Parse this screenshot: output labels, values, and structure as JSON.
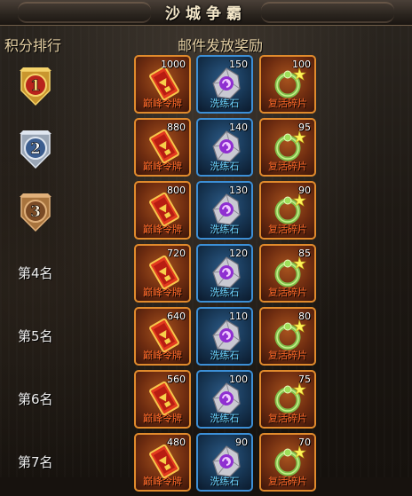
{
  "header": {
    "title": "沙城争霸",
    "rank_column": "积分排行",
    "reward_column": "邮件发放奖励"
  },
  "colors": {
    "gold_text": "#e4cfa3",
    "orange_frame": "#e08a2c",
    "blue_frame": "#3c8fd6",
    "orange_label": "#ff6a2a",
    "blue_label": "#6fd6ff"
  },
  "rows": [
    {
      "rank_badge": "1",
      "rank_icon": "gold-rank-medal-icon",
      "rewards": [
        {
          "name": "巅峰令牌",
          "count": "1000",
          "icon": "token-card-icon"
        },
        {
          "name": "洗练石",
          "count": "150",
          "icon": "purple-stone-icon"
        },
        {
          "name": "复活碎片",
          "count": "100",
          "icon": "green-ring-icon"
        }
      ]
    },
    {
      "rank_badge": "2",
      "rank_icon": "silver-rank-medal-icon",
      "rewards": [
        {
          "name": "巅峰令牌",
          "count": "880",
          "icon": "token-card-icon"
        },
        {
          "name": "洗练石",
          "count": "140",
          "icon": "purple-stone-icon"
        },
        {
          "name": "复活碎片",
          "count": "95",
          "icon": "green-ring-icon"
        }
      ]
    },
    {
      "rank_badge": "3",
      "rank_icon": "bronze-rank-medal-icon",
      "rewards": [
        {
          "name": "巅峰令牌",
          "count": "800",
          "icon": "token-card-icon"
        },
        {
          "name": "洗练石",
          "count": "130",
          "icon": "purple-stone-icon"
        },
        {
          "name": "复活碎片",
          "count": "90",
          "icon": "green-ring-icon"
        }
      ]
    },
    {
      "rank_text": "第4名",
      "rewards": [
        {
          "name": "巅峰令牌",
          "count": "720",
          "icon": "token-card-icon"
        },
        {
          "name": "洗练石",
          "count": "120",
          "icon": "purple-stone-icon"
        },
        {
          "name": "复活碎片",
          "count": "85",
          "icon": "green-ring-icon"
        }
      ]
    },
    {
      "rank_text": "第5名",
      "rewards": [
        {
          "name": "巅峰令牌",
          "count": "640",
          "icon": "token-card-icon"
        },
        {
          "name": "洗练石",
          "count": "110",
          "icon": "purple-stone-icon"
        },
        {
          "name": "复活碎片",
          "count": "80",
          "icon": "green-ring-icon"
        }
      ]
    },
    {
      "rank_text": "第6名",
      "rewards": [
        {
          "name": "巅峰令牌",
          "count": "560",
          "icon": "token-card-icon"
        },
        {
          "name": "洗练石",
          "count": "100",
          "icon": "purple-stone-icon"
        },
        {
          "name": "复活碎片",
          "count": "75",
          "icon": "green-ring-icon"
        }
      ]
    },
    {
      "rank_text": "第7名",
      "rewards": [
        {
          "name": "巅峰令牌",
          "count": "480",
          "icon": "token-card-icon"
        },
        {
          "name": "洗练石",
          "count": "90",
          "icon": "purple-stone-icon"
        },
        {
          "name": "复活碎片",
          "count": "70",
          "icon": "green-ring-icon"
        }
      ]
    }
  ]
}
